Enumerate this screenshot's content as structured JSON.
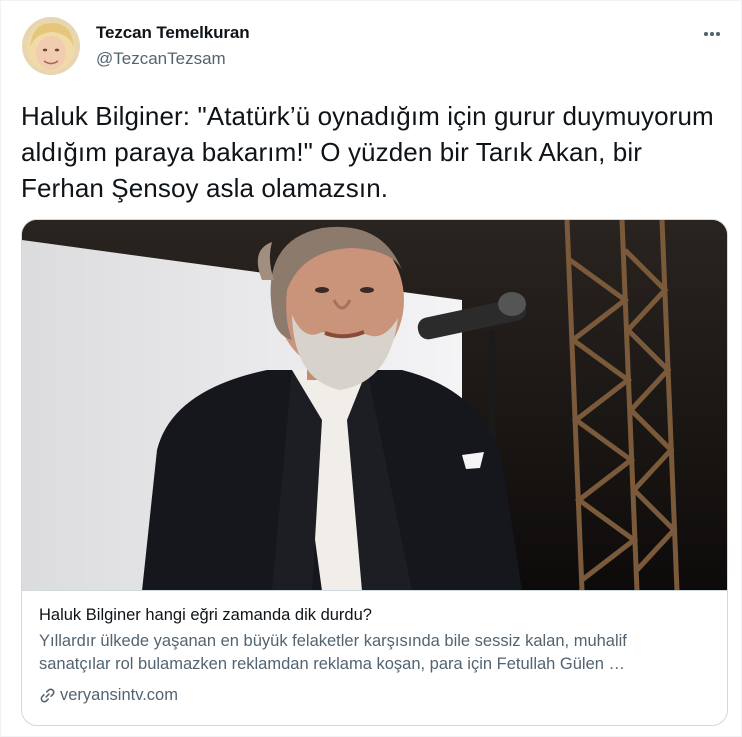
{
  "tweet": {
    "author": {
      "name": "Tezcan Temelkuran",
      "handle": "@TezcanTezsam"
    },
    "text": "Haluk Bilginer: \"Atatürk’ü oynadığım için gurur duymuyorum aldığım paraya bakarım!\" O yüzden bir Tarık Akan, bir Ferhan Şensoy asla olamazsın.",
    "card": {
      "title": "Haluk Bilginer hangi eğri zamanda dik durdu?",
      "description_line1": "Yıllardır ülkede yaşanan en büyük felaketler karşısında bile sessiz kalan, muhalif",
      "description_line2": "sanatçılar rol bulamazken reklamdan reklama koşan, para için Fetullah Gülen …",
      "domain": "veryansintv.com"
    }
  },
  "icons": {
    "more": "more-horizontal-icon",
    "link": "link-icon"
  },
  "colors": {
    "text_primary": "#0f1419",
    "text_secondary": "#536471",
    "border": "#cfd9de"
  }
}
